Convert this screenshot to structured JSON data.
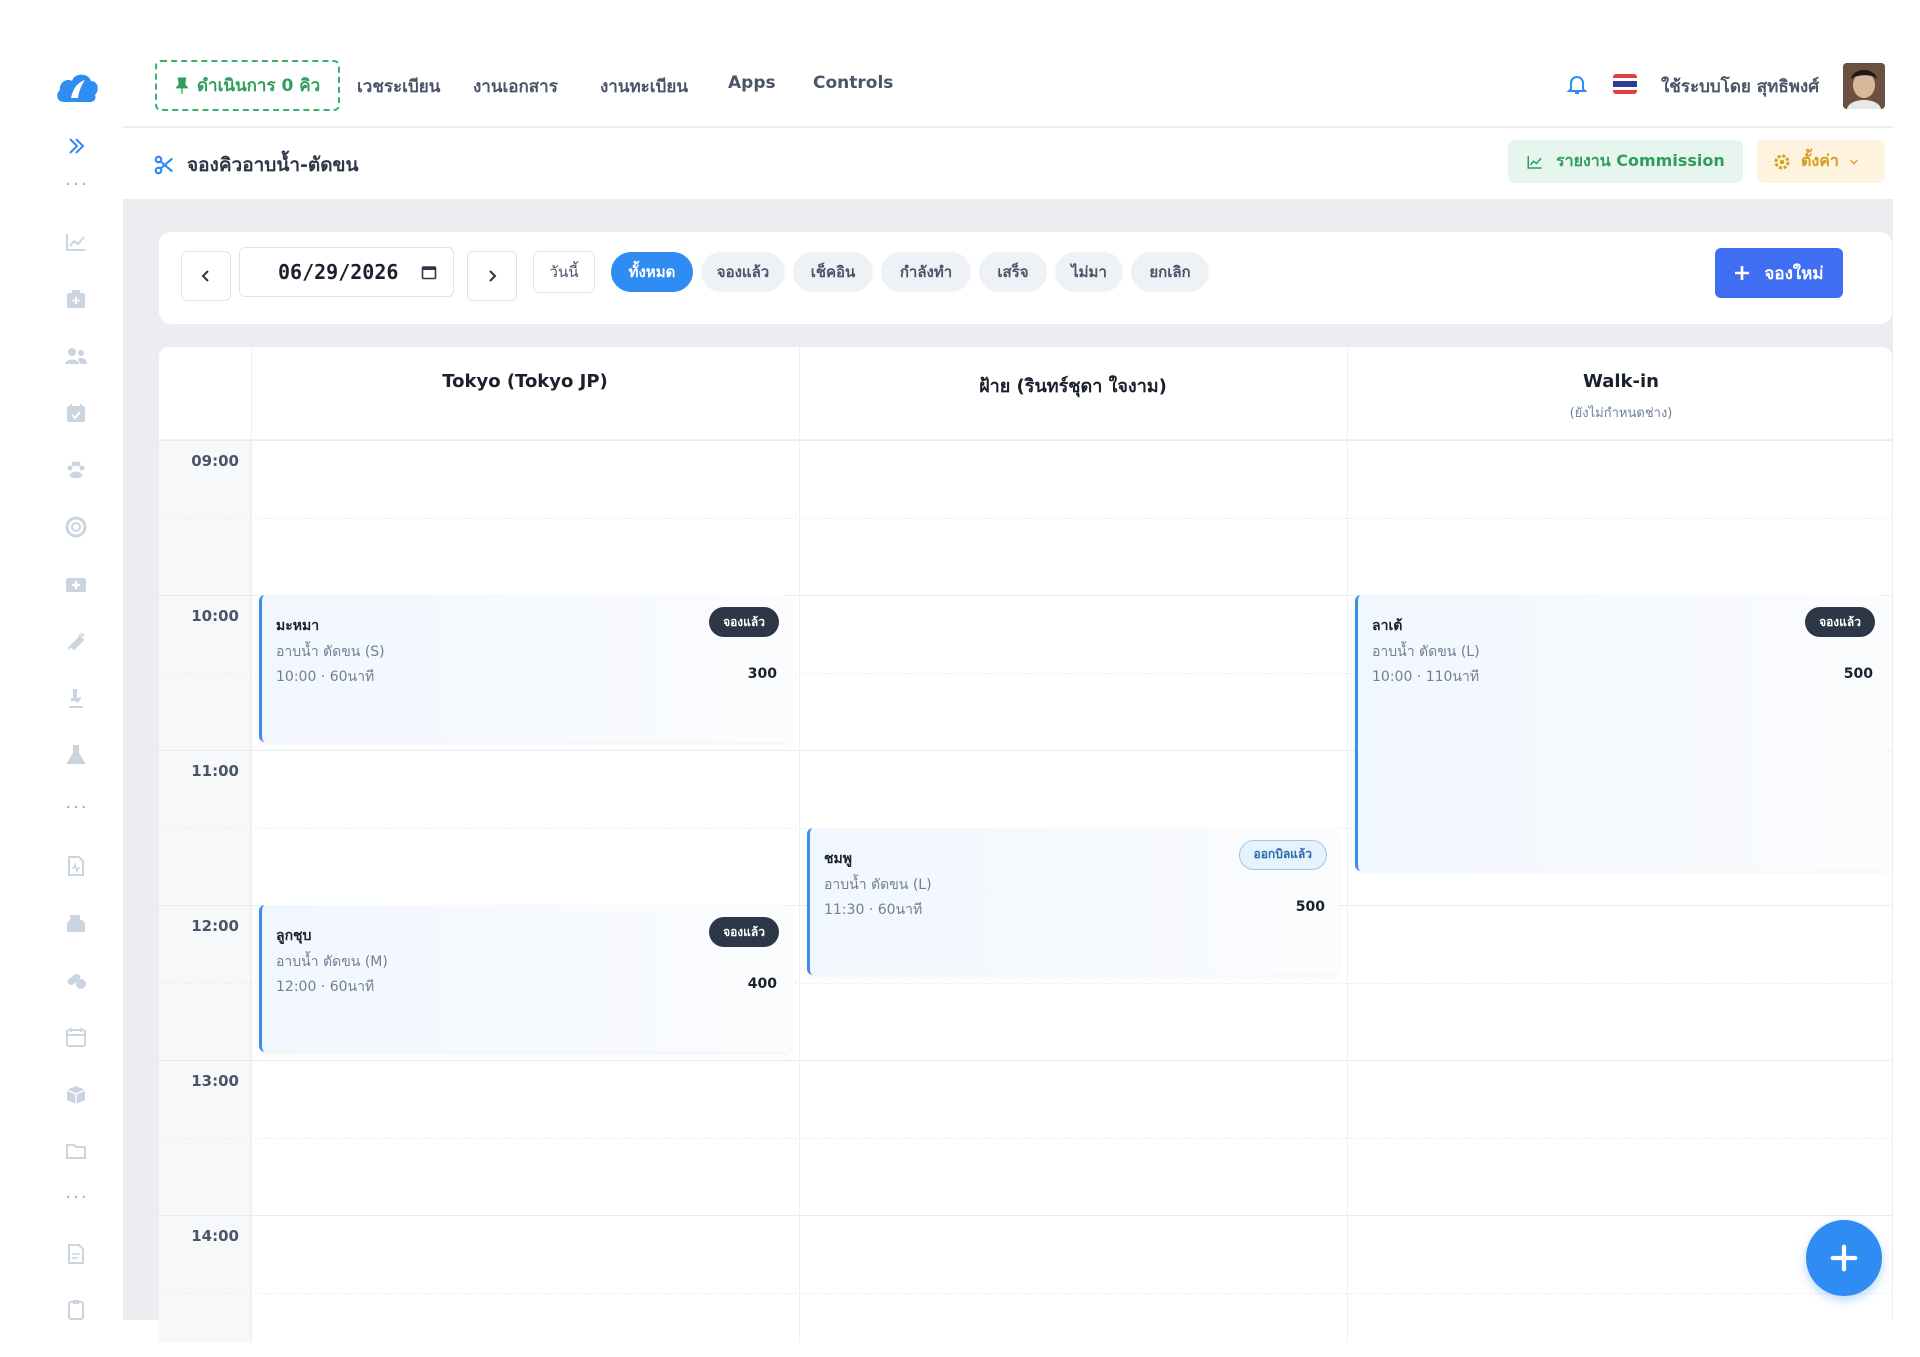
{
  "topbar": {
    "queue_pill": "ดำเนินการ 0 คิว",
    "nav": [
      "เวชระเบียน",
      "งานเอกสาร",
      "งานทะเบียน",
      "Apps",
      "Controls"
    ],
    "user_label": "ใช้ระบบโดย สุทธิพงศ์"
  },
  "page": {
    "title": "จองคิวอาบน้ำ-ตัดขน",
    "commission_label": "รายงาน Commission",
    "settings_label": "ตั้งค่า"
  },
  "toolbar": {
    "date_value": "06/29/2026",
    "today_label": "วันนี้",
    "filters": [
      {
        "label": "ทั้งหมด",
        "active": true
      },
      {
        "label": "จองแล้ว",
        "active": false
      },
      {
        "label": "เช็คอิน",
        "active": false
      },
      {
        "label": "กำลังทำ",
        "active": false
      },
      {
        "label": "เสร็จ",
        "active": false
      },
      {
        "label": "ไม่มา",
        "active": false
      },
      {
        "label": "ยกเลิก",
        "active": false
      }
    ],
    "new_label": "จองใหม่"
  },
  "calendar": {
    "columns": [
      {
        "title": "Tokyo (Tokyo JP)",
        "sub": ""
      },
      {
        "title": "ฝ้าย (รินทร์ชุดา ใจงาม)",
        "sub": ""
      },
      {
        "title": "Walk-in",
        "sub": "(ยังไม่กำหนดช่าง)"
      }
    ],
    "times": [
      "09:00",
      "10:00",
      "11:00",
      "12:00",
      "13:00",
      "14:00"
    ],
    "appointments": [
      {
        "name": "มะหมา",
        "service": "อาบน้ำ ตัดขน (S)",
        "time": "10:00 · 60นาที",
        "price": "300",
        "status": "จองแล้ว",
        "col": 0,
        "start": "10:00",
        "minutes": 60
      },
      {
        "name": "ลูกชุบ",
        "service": "อาบน้ำ ตัดขน (M)",
        "time": "12:00 · 60นาที",
        "price": "400",
        "status": "จองแล้ว",
        "col": 0,
        "start": "12:00",
        "minutes": 60
      },
      {
        "name": "ชมพู",
        "service": "อาบน้ำ ตัดขน (L)",
        "time": "11:30 · 60นาที",
        "price": "500",
        "status": "ออกบิลแล้ว",
        "col": 1,
        "start": "11:30",
        "minutes": 60
      },
      {
        "name": "ลาเต้",
        "service": "อาบน้ำ ตัดขน (L)",
        "time": "10:00 · 110นาที",
        "price": "500",
        "status": "จองแล้ว",
        "col": 2,
        "start": "10:00",
        "minutes": 110
      }
    ]
  },
  "colors": {
    "accent_blue": "#2f8cf2",
    "primary_button": "#3f6ef3",
    "green": "#2f9e5c",
    "amber": "#d69e1e",
    "badge_dark": "#2d3748"
  },
  "icons": {
    "sidebar": [
      "chart-line-icon",
      "hospital-icon",
      "users-icon",
      "calendar-check-icon",
      "paw-icon",
      "lifebuoy-icon",
      "medkit-icon",
      "syringe-icon",
      "microscope-icon",
      "flask-icon",
      "file-medical-icon",
      "cash-register-icon",
      "pills-icon",
      "calendar-icon",
      "box-icon",
      "folder-icon",
      "file-icon",
      "clipboard-icon"
    ]
  }
}
